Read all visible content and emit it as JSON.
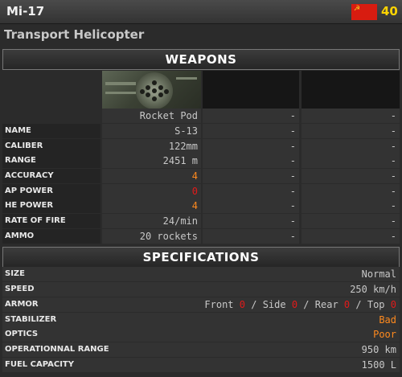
{
  "header": {
    "unit_name": "Mi-17",
    "price": "40",
    "flag": "ussr-flag",
    "unit_type": "Transport Helicopter"
  },
  "weapons": {
    "title": "WEAPONS",
    "slot_images": [
      "rocket-pod-image",
      "",
      ""
    ],
    "weapon_names": [
      "Rocket Pod",
      "-",
      "-"
    ],
    "rows": [
      {
        "label": "NAME",
        "values": [
          "S-13",
          "-",
          "-"
        ]
      },
      {
        "label": "CALIBER",
        "values": [
          "122mm",
          "-",
          "-"
        ]
      },
      {
        "label": "RANGE",
        "values": [
          "2451 m",
          "-",
          "-"
        ]
      },
      {
        "label": "ACCURACY",
        "values": [
          "4",
          "-",
          "-"
        ]
      },
      {
        "label": "AP POWER",
        "values": [
          "0",
          "-",
          "-"
        ]
      },
      {
        "label": "HE POWER",
        "values": [
          "4",
          "-",
          "-"
        ]
      },
      {
        "label": "RATE OF FIRE",
        "values": [
          "24/min",
          "-",
          "-"
        ]
      },
      {
        "label": "AMMO",
        "values": [
          "20 rockets",
          "-",
          "-"
        ]
      }
    ]
  },
  "specifications": {
    "title": "SPECIFICATIONS",
    "rows": [
      {
        "label": "SIZE",
        "value": "Normal"
      },
      {
        "label": "SPEED",
        "value": "250 km/h"
      },
      {
        "label": "ARMOR",
        "armor": {
          "front_label": "Front",
          "front": "0",
          "side_label": "Side",
          "side": "0",
          "rear_label": "Rear",
          "rear": "0",
          "top_label": "Top",
          "top": "0",
          "separator": "/"
        }
      },
      {
        "label": "STABILIZER",
        "value": "Bad"
      },
      {
        "label": "OPTICS",
        "value": "Poor"
      },
      {
        "label": "OPERATIONNAL RANGE",
        "value": "950 km"
      },
      {
        "label": "FUEL CAPACITY",
        "value": "1500 L"
      }
    ]
  },
  "colors": {
    "price": "#ffd400",
    "flag_red": "#d81c10",
    "highlight_orange": "#ff8a1e",
    "highlight_red": "#e21a1a"
  }
}
